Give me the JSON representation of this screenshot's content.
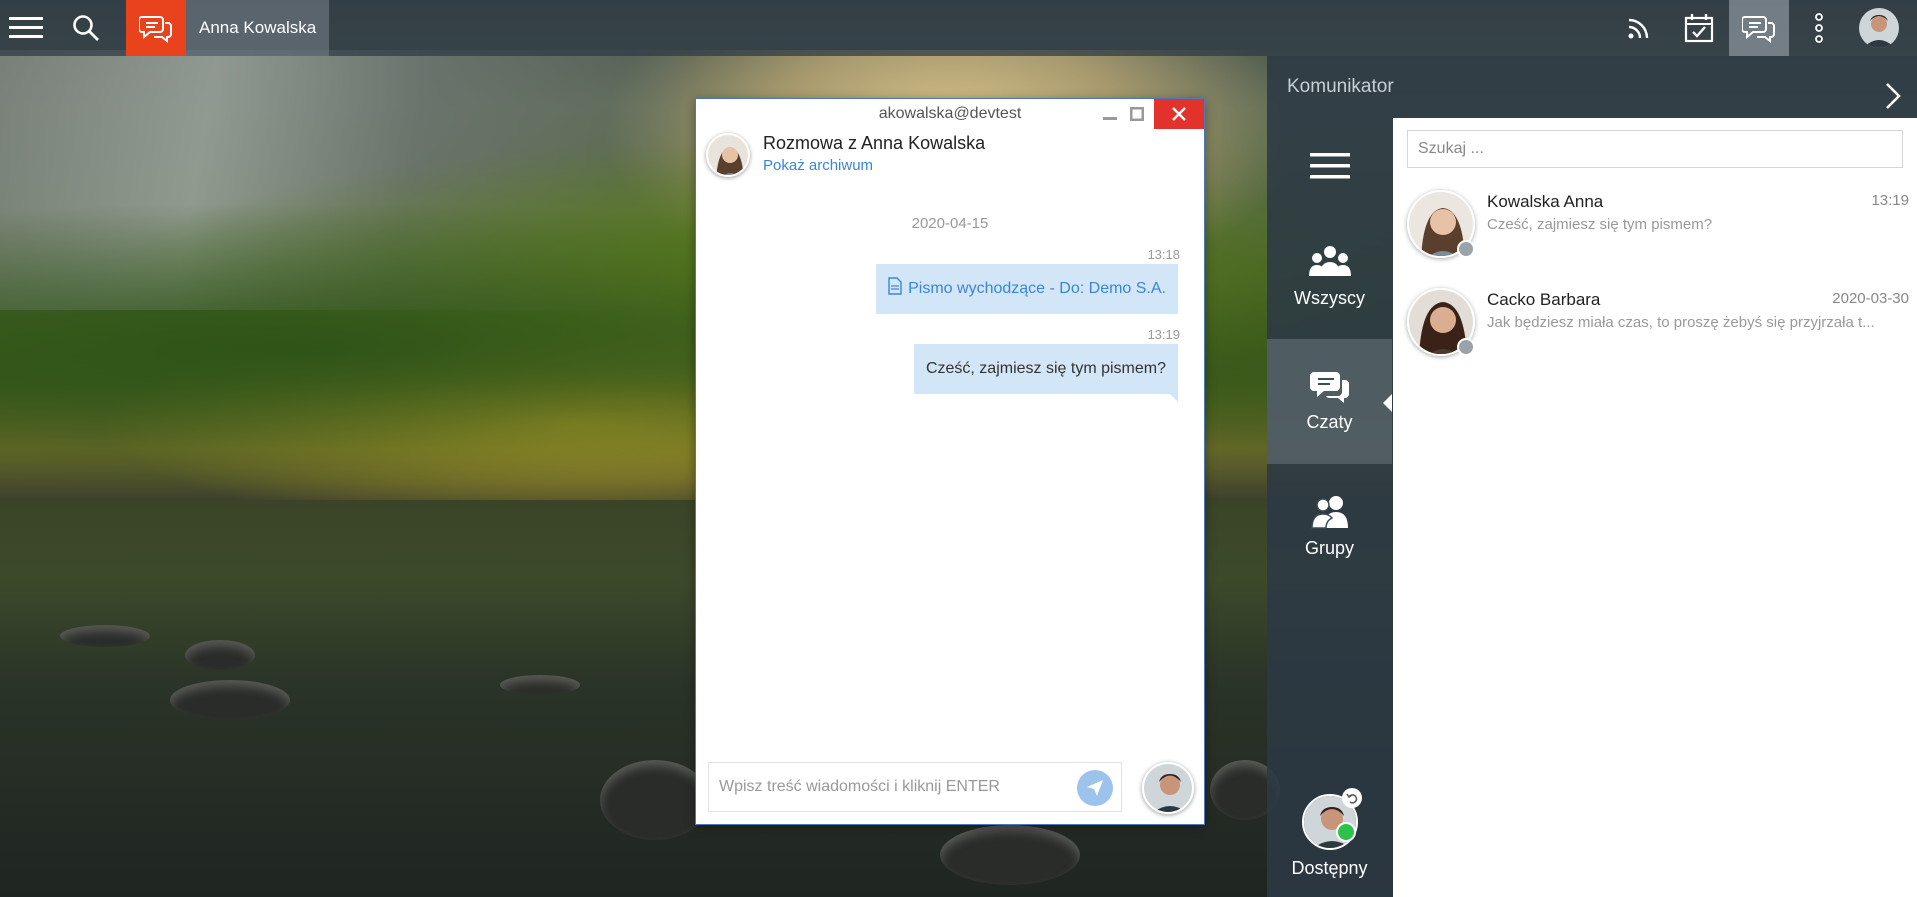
{
  "topbar": {
    "user_name": "Anna Kowalska",
    "icons": [
      "menu-icon",
      "search-icon",
      "chat-icon",
      "rss-icon",
      "calendar-check-icon",
      "chat-icon",
      "more-vertical-icon",
      "avatar"
    ],
    "accent": "#e8431c"
  },
  "chat_window": {
    "title": "akowalska@devtest",
    "conversation_title": "Rozmowa z Anna Kowalska",
    "archive_link": "Pokaż archiwum",
    "date": "2020-04-15",
    "messages": [
      {
        "time": "13:18",
        "text": "Pismo wychodzące - Do: Demo S.A.",
        "type": "document-link"
      },
      {
        "time": "13:19",
        "text": "Cześć, zajmiesz się tym pismem?",
        "type": "text"
      }
    ],
    "input_placeholder": "Wpisz treść wiadomości i kliknij ENTER",
    "close_color": "#e3312c"
  },
  "messenger": {
    "title": "Komunikator",
    "nav": [
      {
        "label": "Wszyscy",
        "icon": "group-icon"
      },
      {
        "label": "Czaty",
        "icon": "chats-icon"
      },
      {
        "label": "Grupy",
        "icon": "users-icon"
      }
    ],
    "status_label": "Dostępny",
    "status_color": "#2fc24a",
    "search_placeholder": "Szukaj ...",
    "conversations": [
      {
        "name": "Kowalska Anna",
        "time": "13:19",
        "preview": "Cześć, zajmiesz się tym pismem?"
      },
      {
        "name": "Cacko Barbara",
        "time": "2020-03-30",
        "preview": "Jak będziesz miała czas, to proszę żebyś się przyjrzała t..."
      }
    ]
  }
}
